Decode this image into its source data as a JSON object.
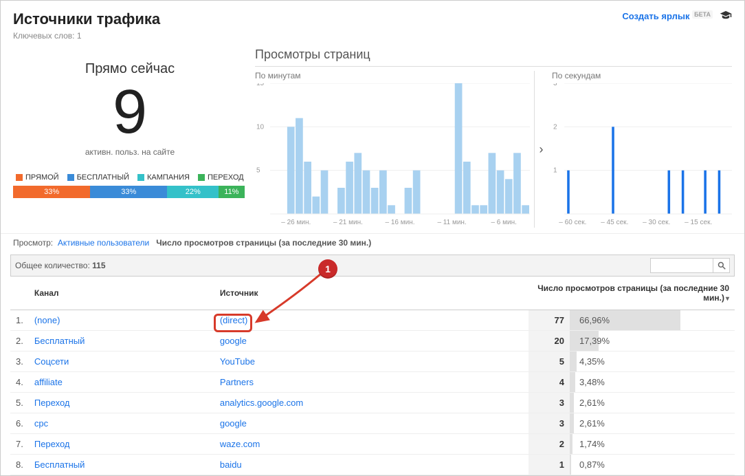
{
  "header": {
    "title": "Источники трафика",
    "subtitle_prefix": "Ключевых слов:",
    "subtitle_count": "1",
    "create_shortcut": "Создать ярлык",
    "beta": "БЕТА"
  },
  "realtime": {
    "now_label": "Прямо сейчас",
    "count": "9",
    "active_label": "активн. польз. на сайте",
    "legend": [
      {
        "label": "ПРЯМОЙ",
        "color": "#f26a2c"
      },
      {
        "label": "БЕСПЛАТНЫЙ",
        "color": "#3a8bd8"
      },
      {
        "label": "КАМПАНИЯ",
        "color": "#34c1c9"
      },
      {
        "label": "ПЕРЕХОД",
        "color": "#3bb35a"
      }
    ],
    "shares": [
      {
        "pct": 33,
        "color": "#f26a2c",
        "label": "33%"
      },
      {
        "pct": 33,
        "color": "#3a8bd8",
        "label": "33%"
      },
      {
        "pct": 22,
        "color": "#34c1c9",
        "label": "22%"
      },
      {
        "pct": 11,
        "color": "#3bb35a",
        "label": "11%"
      }
    ]
  },
  "charts": {
    "title": "Просмотры страниц",
    "minute_label": "По минутам",
    "second_label": "По секундам",
    "chart_data": [
      {
        "type": "bar",
        "title": "По минутам",
        "ylabel": "",
        "ylim": [
          0,
          15
        ],
        "y_ticks": [
          5,
          10,
          15
        ],
        "x_ticks": [
          "– 26 мин.",
          "– 21 мин.",
          "– 16 мин.",
          "– 11 мин.",
          "– 6 мин."
        ],
        "values": [
          0,
          0,
          10,
          11,
          6,
          2,
          5,
          0,
          3,
          6,
          7,
          5,
          3,
          5,
          1,
          0,
          3,
          5,
          0,
          0,
          0,
          0,
          15,
          6,
          1,
          1,
          7,
          5,
          4,
          7,
          1
        ]
      },
      {
        "type": "bar",
        "title": "По секундам",
        "ylabel": "",
        "ylim": [
          0,
          3
        ],
        "y_ticks": [
          1,
          2,
          3
        ],
        "x_ticks": [
          "– 60 сек.",
          "– 45 сек.",
          "– 30 сек.",
          "– 15 сек."
        ],
        "values_sparse": [
          {
            "idx": 1,
            "v": 1
          },
          {
            "idx": 17,
            "v": 2
          },
          {
            "idx": 37,
            "v": 1
          },
          {
            "idx": 42,
            "v": 1
          },
          {
            "idx": 50,
            "v": 1
          },
          {
            "idx": 55,
            "v": 1
          }
        ],
        "n_slots": 60
      }
    ]
  },
  "viewrow": {
    "prefix": "Просмотр:",
    "link": "Активные пользователи",
    "active": "Число просмотров страницы (за последние 30 мин.)"
  },
  "total": {
    "label": "Общее количество:",
    "value": "115"
  },
  "search": {
    "placeholder": ""
  },
  "table": {
    "col_channel": "Канал",
    "col_source": "Источник",
    "col_metric": "Число просмотров страницы (за последние 30 мин.)",
    "rows": [
      {
        "idx": "1.",
        "channel": "(none)",
        "source": "(direct)",
        "n": "77",
        "pct": "66,96%",
        "pctNum": 66.96
      },
      {
        "idx": "2.",
        "channel": "Бесплатный",
        "source": "google",
        "n": "20",
        "pct": "17,39%",
        "pctNum": 17.39
      },
      {
        "idx": "3.",
        "channel": "Соцсети",
        "source": "YouTube",
        "n": "5",
        "pct": "4,35%",
        "pctNum": 4.35
      },
      {
        "idx": "4.",
        "channel": "affiliate",
        "source": "Partners",
        "n": "4",
        "pct": "3,48%",
        "pctNum": 3.48
      },
      {
        "idx": "5.",
        "channel": "Переход",
        "source": "analytics.google.com",
        "n": "3",
        "pct": "2,61%",
        "pctNum": 2.61
      },
      {
        "idx": "6.",
        "channel": "cpc",
        "source": "google",
        "n": "3",
        "pct": "2,61%",
        "pctNum": 2.61
      },
      {
        "idx": "7.",
        "channel": "Переход",
        "source": "waze.com",
        "n": "2",
        "pct": "1,74%",
        "pctNum": 1.74
      },
      {
        "idx": "8.",
        "channel": "Бесплатный",
        "source": "baidu",
        "n": "1",
        "pct": "0,87%",
        "pctNum": 0.87
      }
    ]
  },
  "annotation": {
    "badge": "1"
  }
}
